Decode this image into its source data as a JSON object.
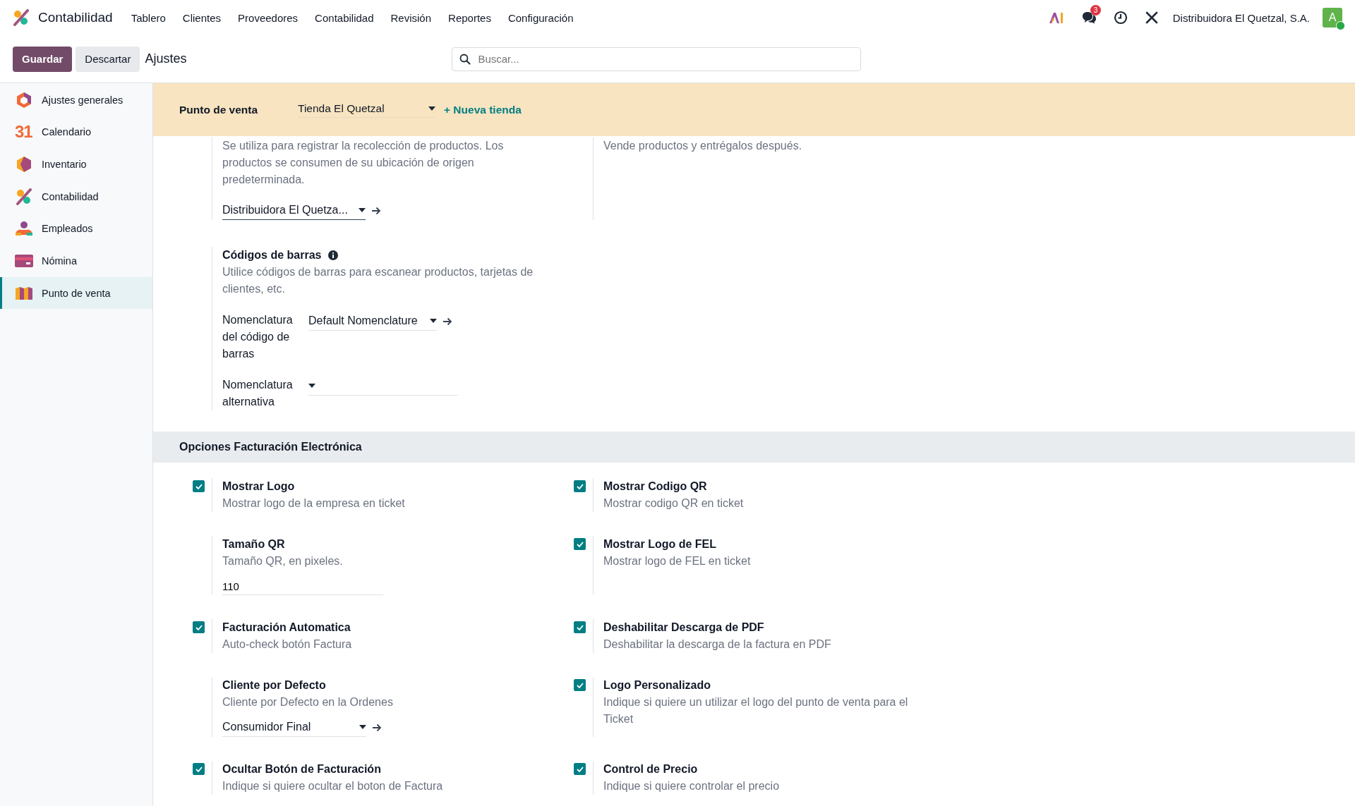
{
  "navbar": {
    "app_name": "Contabilidad",
    "menu": [
      "Tablero",
      "Clientes",
      "Proveedores",
      "Contabilidad",
      "Revisión",
      "Reportes",
      "Configuración"
    ],
    "messages_badge": "3",
    "company": "Distribuidora El Quetzal, S.A.",
    "avatar": "A"
  },
  "control_panel": {
    "save_button": "Guardar",
    "discard_button": "Descartar",
    "breadcrumb": "Ajustes",
    "search": {
      "placeholder": "Buscar..."
    }
  },
  "sidebar": {
    "items": [
      {
        "label": "Ajustes generales",
        "selected": false
      },
      {
        "label": "Calendario",
        "selected": false,
        "icon_text": "31"
      },
      {
        "label": "Inventario",
        "selected": false
      },
      {
        "label": "Contabilidad",
        "selected": false
      },
      {
        "label": "Empleados",
        "selected": false
      },
      {
        "label": "Nómina",
        "selected": false
      },
      {
        "label": "Punto de venta",
        "selected": true
      }
    ]
  },
  "settings_bar": {
    "title": "Punto de venta",
    "store": "Tienda El Quetzal",
    "new_store": "+ Nueva tienda"
  },
  "upper_settings": [
    {
      "kind": "select",
      "description": "Se utiliza para registrar la recolección de productos. Los productos se consumen de su ubicación de origen predeterminada.",
      "value": "Distribuidora El Quetza...",
      "link": true
    },
    {
      "kind": "text",
      "description": "Vende productos y entrégalos después."
    }
  ],
  "barcodes": {
    "title": "Códigos de barras",
    "description": "Utilice códigos de barras para escanear productos, tarjetas de clientes, etc.",
    "fields": [
      {
        "label": "Nomenclatura del código de barras",
        "value": "Default Nomenclature",
        "link": true
      },
      {
        "label": "Nomenclatura alternativa",
        "link": false
      }
    ]
  },
  "section": {
    "title": "Opciones Facturación Electrónica",
    "settings": [
      {
        "kind": "checkbox",
        "title": "Mostrar Logo",
        "description": "Mostrar logo de la empresa en ticket",
        "checked": true
      },
      {
        "kind": "checkbox",
        "title": "Mostrar Codigo QR",
        "description": "Mostrar codigo QR en ticket",
        "checked": true
      },
      {
        "kind": "input",
        "title": "Tamaño QR",
        "description": "Tamaño QR, en pixeles.",
        "value": "110"
      },
      {
        "kind": "checkbox",
        "title": "Mostrar Logo de FEL",
        "description": "Mostrar logo de FEL en ticket",
        "checked": true
      },
      {
        "kind": "checkbox",
        "title": "Facturación Automatica",
        "description": "Auto-check botón Factura",
        "checked": true
      },
      {
        "kind": "checkbox",
        "title": "Deshabilitar Descarga de PDF",
        "description": "Deshabilitar la descarga de la factura en PDF",
        "checked": true
      },
      {
        "kind": "select",
        "title": "Cliente por Defecto",
        "description": "Cliente por Defecto en la Ordenes",
        "value": "Consumidor Final",
        "link": true
      },
      {
        "kind": "checkbox",
        "title": "Logo Personalizado",
        "description": "Indique si quiere un utilizar el logo del punto de venta para el Ticket",
        "checked": true
      },
      {
        "kind": "checkbox",
        "title": "Ocultar Botón de Facturación",
        "description": "Indique si quiere ocultar el boton de Factura",
        "checked": true
      },
      {
        "kind": "checkbox",
        "title": "Control de Precio",
        "description": "Indique si quiere controlar el precio",
        "checked": true
      }
    ]
  }
}
